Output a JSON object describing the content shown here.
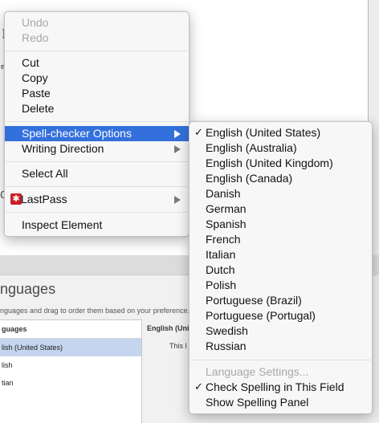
{
  "background": {
    "left_fragment_1": "]",
    "left_fragment_2": "m",
    "left_fragment_3": "C",
    "panel_title": "nguages",
    "panel_subtitle": "nguages and drag to order them based on your preference.",
    "list_header": "guages",
    "list_items": [
      "lish (United States)",
      "lish",
      "tian"
    ],
    "detail_title": "English (Uni",
    "detail_text": "This l"
  },
  "context_menu": {
    "items": [
      {
        "label": "Undo",
        "enabled": false
      },
      {
        "label": "Redo",
        "enabled": false
      },
      {
        "label": "Cut"
      },
      {
        "label": "Copy"
      },
      {
        "label": "Paste"
      },
      {
        "label": "Delete"
      },
      {
        "label": "Spell-checker Options",
        "submenu": true,
        "highlighted": true
      },
      {
        "label": "Writing Direction",
        "submenu": true
      },
      {
        "label": "Select All"
      },
      {
        "label": "LastPass",
        "submenu": true,
        "icon": "lastpass-icon"
      },
      {
        "label": "Inspect Element"
      }
    ]
  },
  "spell_submenu": {
    "languages": [
      {
        "label": "English (United States)",
        "checked": true
      },
      {
        "label": "English (Australia)"
      },
      {
        "label": "English (United Kingdom)"
      },
      {
        "label": "English (Canada)"
      },
      {
        "label": "Danish"
      },
      {
        "label": "German"
      },
      {
        "label": "Spanish"
      },
      {
        "label": "French"
      },
      {
        "label": "Italian"
      },
      {
        "label": "Dutch"
      },
      {
        "label": "Polish"
      },
      {
        "label": "Portuguese (Brazil)"
      },
      {
        "label": "Portuguese (Portugal)"
      },
      {
        "label": "Swedish"
      },
      {
        "label": "Russian"
      }
    ],
    "language_settings": {
      "label": "Language Settings...",
      "enabled": false
    },
    "check_spelling": {
      "label": "Check Spelling in This Field",
      "checked": true
    },
    "show_panel": {
      "label": "Show Spelling Panel"
    },
    "check_glyph": "✓"
  },
  "colors": {
    "highlight": "#3470dc",
    "lastpass_red": "#c61f2b"
  }
}
